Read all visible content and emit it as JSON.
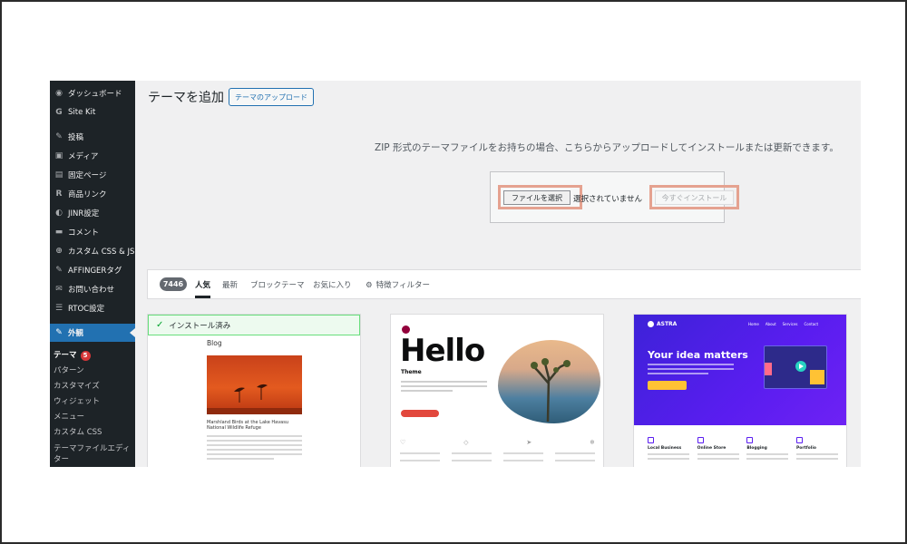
{
  "sidebar": {
    "items": [
      {
        "icon": "dashboard-icon",
        "glyph": "◉",
        "label": "ダッシュボード"
      },
      {
        "icon": "sitekit-icon",
        "glyph": "G",
        "label": "Site Kit"
      },
      {
        "icon": "pin-icon",
        "glyph": "✎",
        "label": "投稿"
      },
      {
        "icon": "media-icon",
        "glyph": "▣",
        "label": "メディア"
      },
      {
        "icon": "page-icon",
        "glyph": "▤",
        "label": "固定ページ"
      },
      {
        "icon": "link-icon",
        "glyph": "R",
        "label": "商品リンク"
      },
      {
        "icon": "jinr-icon",
        "glyph": "◐",
        "label": "JINR設定"
      },
      {
        "icon": "comment-icon",
        "glyph": "▬",
        "label": "コメント"
      },
      {
        "icon": "plus-icon",
        "glyph": "⊕",
        "label": "カスタム CSS & JS"
      },
      {
        "icon": "pin-icon",
        "glyph": "✎",
        "label": "AFFINGERタグ"
      },
      {
        "icon": "mail-icon",
        "glyph": "✉",
        "label": "お問い合わせ"
      },
      {
        "icon": "toc-icon",
        "glyph": "☰",
        "label": "RTOC設定"
      }
    ],
    "active": {
      "icon": "brush-icon",
      "glyph": "✎",
      "label": "外観"
    },
    "submenu": [
      {
        "label": "テーマ",
        "badge": "5"
      },
      {
        "label": "パターン"
      },
      {
        "label": "カスタマイズ"
      },
      {
        "label": "ウィジェット"
      },
      {
        "label": "メニュー"
      },
      {
        "label": "カスタム CSS"
      },
      {
        "label": "テーマファイルエディ"
      },
      {
        "label": "ター"
      }
    ]
  },
  "header": {
    "title": "テーマを追加",
    "upload_button": "テーマのアップロード"
  },
  "upload": {
    "description": "ZIP 形式のテーマファイルをお持ちの場合、こちらからアップロードしてインストールまたは更新できます。",
    "file_button": "ファイルを選択",
    "no_file": "選択されていません",
    "install_button": "今すぐインストール"
  },
  "filter": {
    "count": "7446",
    "tabs": [
      "人気",
      "最新",
      "ブロックテーマ",
      "お気に入り"
    ],
    "feature_filter": "特徴フィルター"
  },
  "themes": [
    {
      "installed_label": "インストール済み",
      "preview_label": "Blog",
      "preview_caption": "Marshland Birds at the Lake Havasu National Wildlife Refuge"
    },
    {
      "preview_title": "Hello",
      "preview_subtitle": "Theme"
    },
    {
      "brand": "ASTRA",
      "headline": "Your idea matters",
      "nav": [
        "Home",
        "About",
        "Services",
        "Contact"
      ],
      "features": [
        "Local Business",
        "Online Store",
        "Blogging",
        "Portfolio"
      ]
    }
  ],
  "colors": {
    "sidebar_bg": "#1d2327",
    "active": "#2271b1",
    "highlight": "#e5a290",
    "astra_purple": "#5a1df0"
  }
}
